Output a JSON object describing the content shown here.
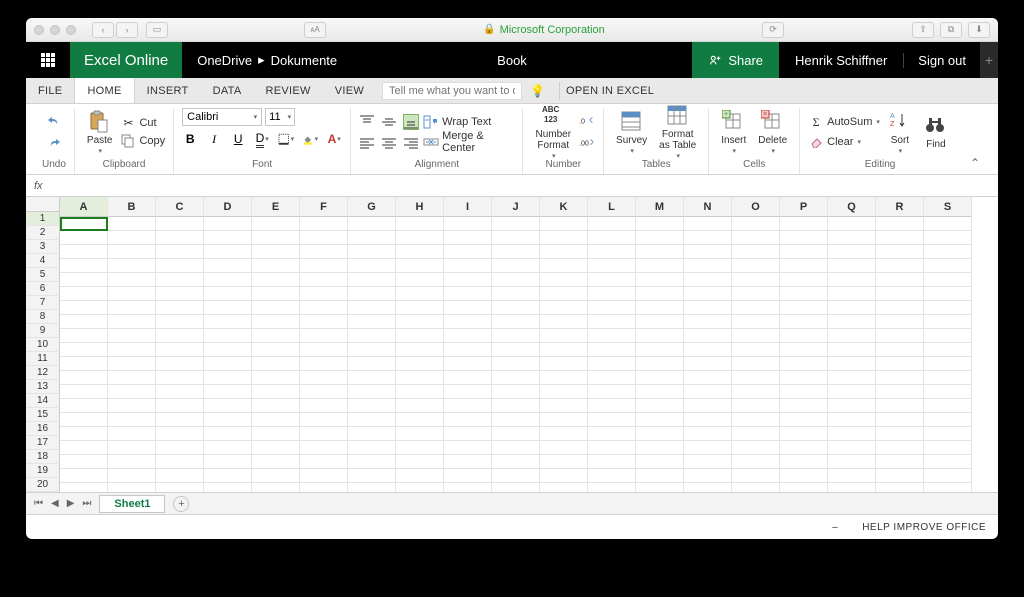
{
  "mac": {
    "url_label": "Microsoft Corporation"
  },
  "app": {
    "brand": "Excel Online",
    "crumb_root": "OneDrive",
    "crumb_sep": "▸",
    "crumb_folder": "Dokumente",
    "doc_title": "Book",
    "share": "Share",
    "user": "Henrik Schiffner",
    "signout": "Sign out"
  },
  "tabs": {
    "file": "FILE",
    "home": "HOME",
    "insert": "INSERT",
    "data": "DATA",
    "review": "REVIEW",
    "view": "VIEW",
    "tellme_placeholder": "Tell me what you want to do",
    "openin": "OPEN IN EXCEL"
  },
  "ribbon": {
    "undo_group": "Undo",
    "clipboard": {
      "label": "Clipboard",
      "paste": "Paste",
      "cut": "Cut",
      "copy": "Copy"
    },
    "font": {
      "label": "Font",
      "name": "Calibri",
      "size": "11"
    },
    "alignment": {
      "label": "Alignment",
      "wrap": "Wrap Text",
      "merge": "Merge & Center"
    },
    "number": {
      "label": "Number",
      "format": "Number\nFormat"
    },
    "tables": {
      "label": "Tables",
      "survey": "Survey",
      "fmt": "Format\nas Table"
    },
    "cells": {
      "label": "Cells",
      "insert": "Insert",
      "delete": "Delete"
    },
    "editing": {
      "label": "Editing",
      "autosum": "AutoSum",
      "clear": "Clear",
      "sort": "Sort",
      "find": "Find"
    }
  },
  "fx": {
    "label": "fx"
  },
  "grid": {
    "columns": [
      "A",
      "B",
      "C",
      "D",
      "E",
      "F",
      "G",
      "H",
      "I",
      "J",
      "K",
      "L",
      "M",
      "N",
      "O",
      "P",
      "Q",
      "R",
      "S"
    ],
    "rows": [
      1,
      2,
      3,
      4,
      5,
      6,
      7,
      8,
      9,
      10,
      11,
      12,
      13,
      14,
      15,
      16,
      17,
      18,
      19,
      20
    ],
    "active_cell": "A1",
    "sheet_name": "Sheet1"
  },
  "footer": {
    "help": "HELP IMPROVE OFFICE"
  }
}
